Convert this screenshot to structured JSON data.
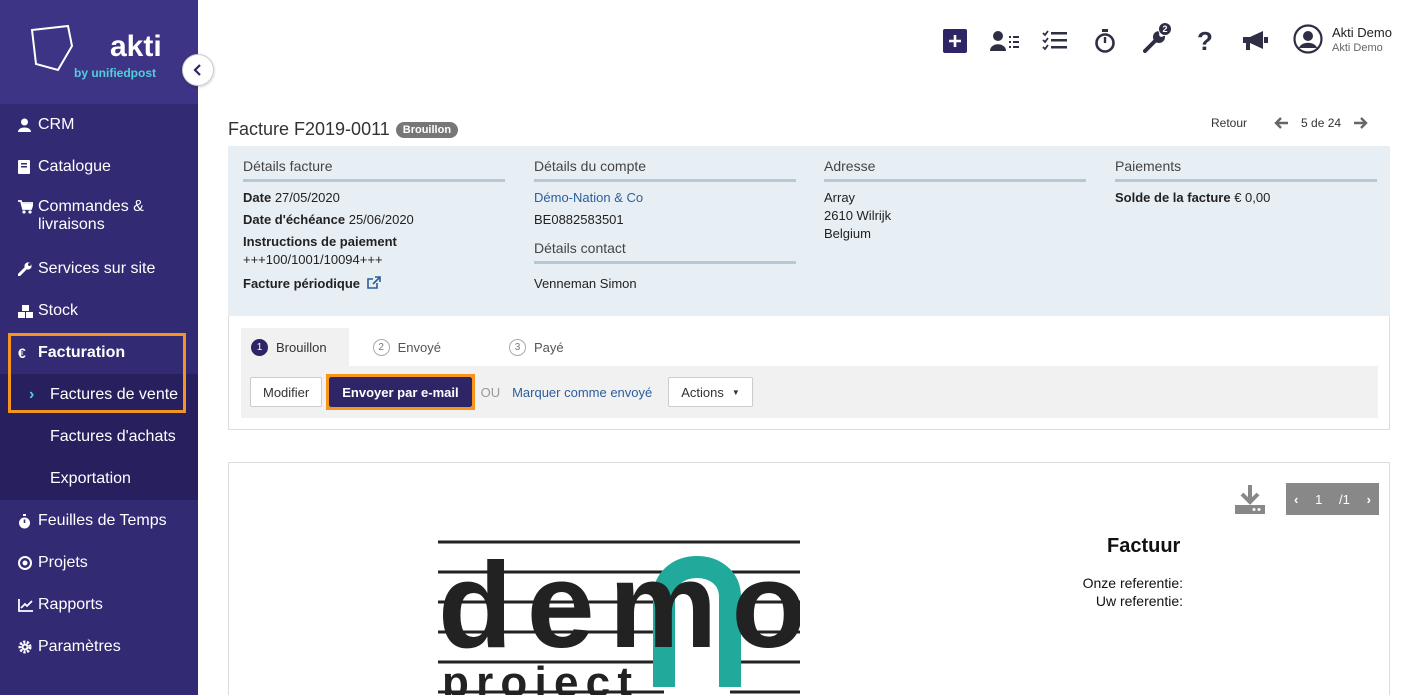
{
  "colors": {
    "sidebar_bg": "#322a73",
    "accent_orange": "#f7941d",
    "primary": "#2e2567",
    "link": "#2b5e9c"
  },
  "brand": {
    "name": "akti",
    "sub": "by unifiedpost"
  },
  "sidebar": {
    "items": [
      {
        "label": "CRM",
        "icon": "user-icon"
      },
      {
        "label": "Catalogue",
        "icon": "book-icon"
      },
      {
        "label": "Commandes &",
        "label2": "livraisons",
        "icon": "cart-icon"
      },
      {
        "label": "Services sur site",
        "icon": "wrench-icon"
      },
      {
        "label": "Stock",
        "icon": "cubes-icon"
      },
      {
        "label": "Facturation",
        "icon": "euro-icon"
      },
      {
        "label": "Feuilles de Temps",
        "icon": "stopwatch-icon"
      },
      {
        "label": "Projets",
        "icon": "target-icon"
      },
      {
        "label": "Rapports",
        "icon": "chart-icon"
      },
      {
        "label": "Paramètres",
        "icon": "gear-icon"
      }
    ],
    "sub_items": [
      {
        "label": "Factures de vente"
      },
      {
        "label": "Factures d'achats"
      },
      {
        "label": "Exportation"
      }
    ]
  },
  "topbar": {
    "notif_count": "2",
    "user_name": "Akti Demo",
    "user_company": "Akti Demo"
  },
  "page": {
    "title": "Facture F2019-0011",
    "status": "Brouillon",
    "back_label": "Retour",
    "pager_text": "5 de 24"
  },
  "details": {
    "invoice_heading": "Détails facture",
    "date_label": "Date",
    "date_value": "27/05/2020",
    "due_label": "Date d'échéance",
    "due_value": "25/06/2020",
    "pay_instr_label": "Instructions de paiement",
    "pay_instr_value": "+++100/1001/10094+++",
    "periodic_label": "Facture périodique",
    "account_heading": "Détails du compte",
    "account_name": "Démo-Nation & Co",
    "account_vat": "BE0882583501",
    "contact_heading": "Détails contact",
    "contact_name": "Venneman Simon",
    "address_heading": "Adresse",
    "address_line1": "Array",
    "address_line2": "2610 Wilrijk",
    "address_line3": "Belgium",
    "payments_heading": "Paiements",
    "balance_label": "Solde de la facture",
    "balance_value": "€ 0,00"
  },
  "workflow": {
    "steps": [
      {
        "num": "1",
        "label": "Brouillon"
      },
      {
        "num": "2",
        "label": "Envoyé"
      },
      {
        "num": "3",
        "label": "Payé"
      }
    ],
    "modify_label": "Modifier",
    "send_email_label": "Envoyer par e-mail",
    "or_label": "OU",
    "mark_sent_label": "Marquer comme envoyé",
    "actions_label": "Actions"
  },
  "preview": {
    "page_current": "1",
    "page_total": "/1",
    "doc_title": "Factuur",
    "ref_ours": "Onze referentie:",
    "ref_yours": "Uw referentie:",
    "logo_text_1": "demo",
    "logo_text_2": "project"
  }
}
